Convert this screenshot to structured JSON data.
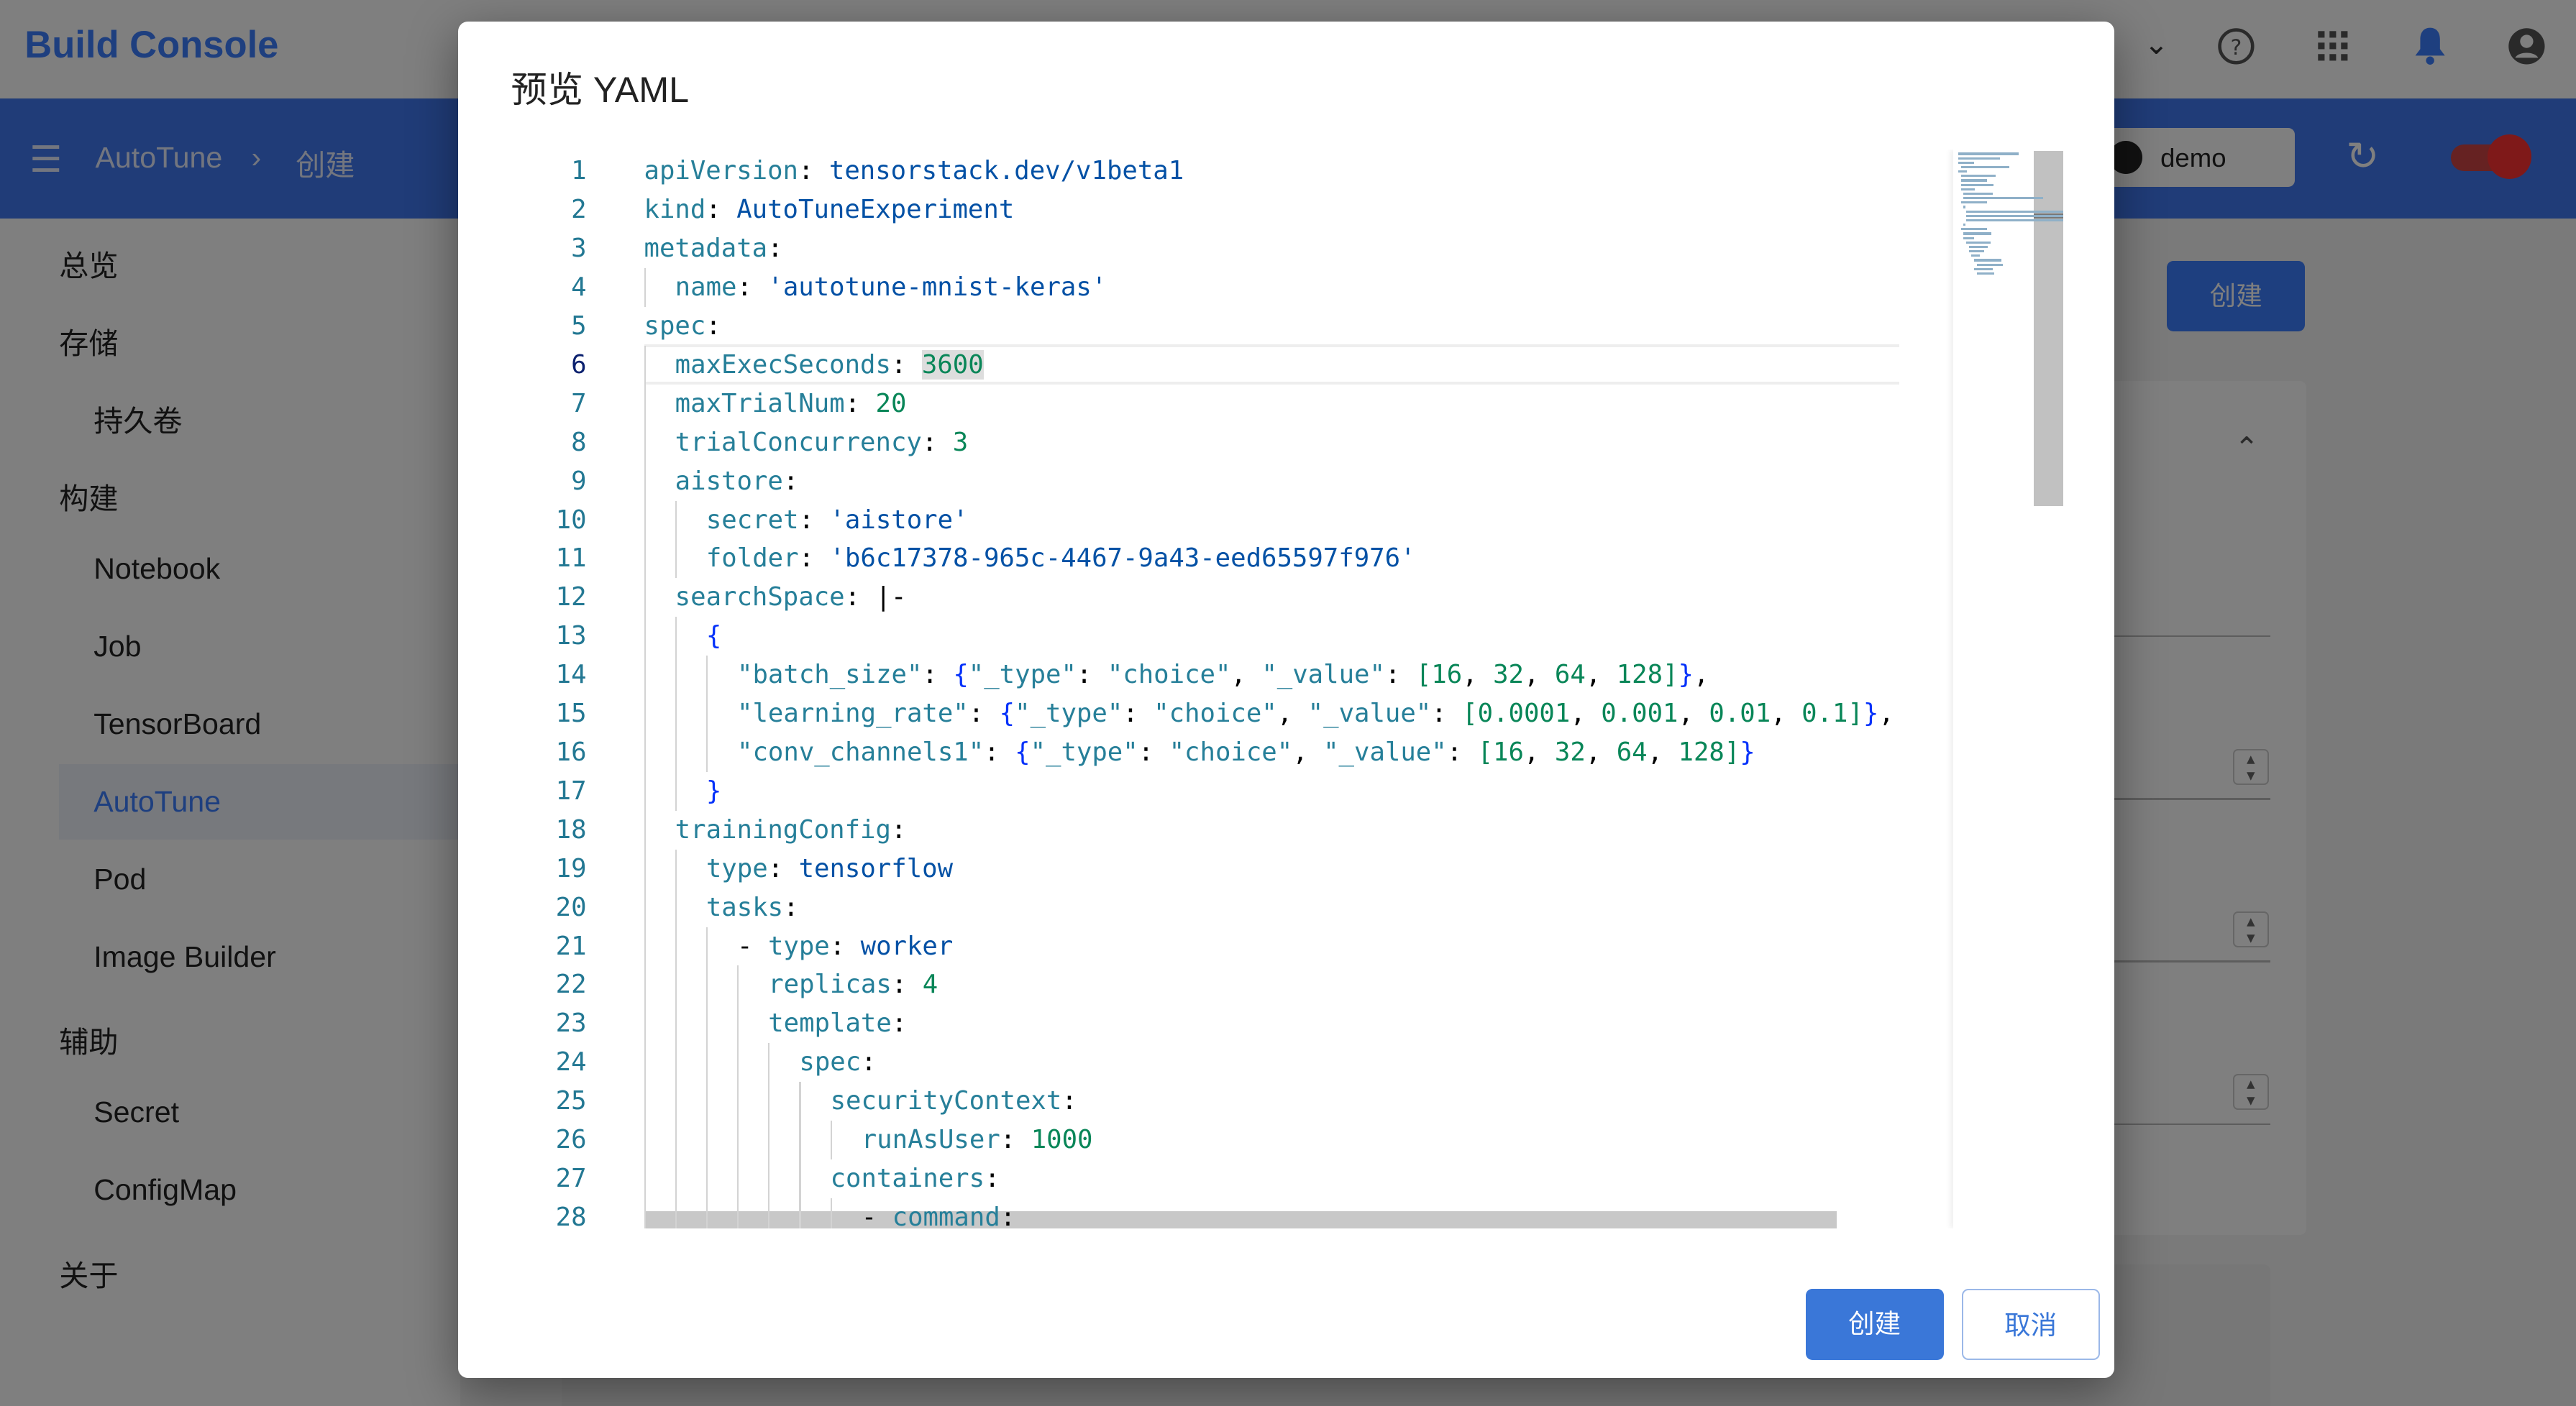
{
  "app": {
    "title": "Build Console",
    "accent": "#3d7eff"
  },
  "header": {
    "icons": [
      "chevron-down-icon",
      "help-icon",
      "apps-icon",
      "bell-icon",
      "account-icon"
    ]
  },
  "navbar": {
    "breadcrumb": [
      "AutoTune",
      "创建"
    ],
    "project": "demo"
  },
  "sidebar": {
    "items": [
      {
        "label": "总览",
        "level": 0
      },
      {
        "label": "存储",
        "level": 0
      },
      {
        "label": "持久卷",
        "level": 1
      },
      {
        "label": "构建",
        "level": 0
      },
      {
        "label": "Notebook",
        "level": 1
      },
      {
        "label": "Job",
        "level": 1
      },
      {
        "label": "TensorBoard",
        "level": 1
      },
      {
        "label": "AutoTune",
        "level": 1,
        "selected": true
      },
      {
        "label": "Pod",
        "level": 1
      },
      {
        "label": "Image Builder",
        "level": 1
      },
      {
        "label": "辅助",
        "level": 0
      },
      {
        "label": "Secret",
        "level": 1
      },
      {
        "label": "ConfigMap",
        "level": 1
      },
      {
        "label": "关于",
        "level": 0
      }
    ]
  },
  "main": {
    "create_label": "创建"
  },
  "dialog": {
    "title": "预览 YAML",
    "confirm_label": "创建",
    "cancel_label": "取消",
    "current_line": 6,
    "lines": [
      {
        "i": 0,
        "t": [
          [
            "k",
            "apiVersion"
          ],
          [
            "p",
            ": "
          ],
          [
            "s",
            "tensorstack.dev/v1beta1"
          ]
        ]
      },
      {
        "i": 0,
        "t": [
          [
            "k",
            "kind"
          ],
          [
            "p",
            ": "
          ],
          [
            "s",
            "AutoTuneExperiment"
          ]
        ]
      },
      {
        "i": 0,
        "t": [
          [
            "k",
            "metadata"
          ],
          [
            "p",
            ":"
          ]
        ]
      },
      {
        "i": 1,
        "t": [
          [
            "k",
            "name"
          ],
          [
            "p",
            ": "
          ],
          [
            "s",
            "'autotune-mnist-keras'"
          ]
        ]
      },
      {
        "i": 0,
        "t": [
          [
            "k",
            "spec"
          ],
          [
            "p",
            ":"
          ]
        ]
      },
      {
        "i": 1,
        "t": [
          [
            "k",
            "maxExecSeconds"
          ],
          [
            "p",
            ": "
          ],
          [
            "n",
            "3600"
          ]
        ]
      },
      {
        "i": 1,
        "t": [
          [
            "k",
            "maxTrialNum"
          ],
          [
            "p",
            ": "
          ],
          [
            "n",
            "20"
          ]
        ]
      },
      {
        "i": 1,
        "t": [
          [
            "k",
            "trialConcurrency"
          ],
          [
            "p",
            ": "
          ],
          [
            "n",
            "3"
          ]
        ]
      },
      {
        "i": 1,
        "t": [
          [
            "k",
            "aistore"
          ],
          [
            "p",
            ":"
          ]
        ]
      },
      {
        "i": 2,
        "t": [
          [
            "k",
            "secret"
          ],
          [
            "p",
            ": "
          ],
          [
            "s",
            "'aistore'"
          ]
        ]
      },
      {
        "i": 2,
        "t": [
          [
            "k",
            "folder"
          ],
          [
            "p",
            ": "
          ],
          [
            "s",
            "'b6c17378-965c-4467-9a43-eed65597f976'"
          ]
        ]
      },
      {
        "i": 1,
        "t": [
          [
            "k",
            "searchSpace"
          ],
          [
            "p",
            ": |-"
          ]
        ]
      },
      {
        "i": 2,
        "t": [
          [
            "b",
            "{"
          ]
        ]
      },
      {
        "i": 3,
        "t": [
          [
            "q",
            "\"batch_size\""
          ],
          [
            "p",
            ": "
          ],
          [
            "b",
            "{"
          ],
          [
            "q",
            "\"_type\""
          ],
          [
            "p",
            ": "
          ],
          [
            "q",
            "\"choice\""
          ],
          [
            "p",
            ", "
          ],
          [
            "q",
            "\"_value\""
          ],
          [
            "p",
            ": "
          ],
          [
            "n",
            "[16"
          ],
          [
            "p",
            ", "
          ],
          [
            "n",
            "32"
          ],
          [
            "p",
            ", "
          ],
          [
            "n",
            "64"
          ],
          [
            "p",
            ", "
          ],
          [
            "n",
            "128]"
          ],
          [
            "b",
            "}"
          ],
          [
            "p",
            ","
          ]
        ]
      },
      {
        "i": 3,
        "t": [
          [
            "q",
            "\"learning_rate\""
          ],
          [
            "p",
            ": "
          ],
          [
            "b",
            "{"
          ],
          [
            "q",
            "\"_type\""
          ],
          [
            "p",
            ": "
          ],
          [
            "q",
            "\"choice\""
          ],
          [
            "p",
            ", "
          ],
          [
            "q",
            "\"_value\""
          ],
          [
            "p",
            ": "
          ],
          [
            "n",
            "[0.0001"
          ],
          [
            "p",
            ", "
          ],
          [
            "n",
            "0.001"
          ],
          [
            "p",
            ", "
          ],
          [
            "n",
            "0.01"
          ],
          [
            "p",
            ", "
          ],
          [
            "n",
            "0.1]"
          ],
          [
            "b",
            "}"
          ],
          [
            "p",
            ","
          ]
        ]
      },
      {
        "i": 3,
        "t": [
          [
            "q",
            "\"conv_channels1\""
          ],
          [
            "p",
            ": "
          ],
          [
            "b",
            "{"
          ],
          [
            "q",
            "\"_type\""
          ],
          [
            "p",
            ": "
          ],
          [
            "q",
            "\"choice\""
          ],
          [
            "p",
            ", "
          ],
          [
            "q",
            "\"_value\""
          ],
          [
            "p",
            ": "
          ],
          [
            "n",
            "[16"
          ],
          [
            "p",
            ", "
          ],
          [
            "n",
            "32"
          ],
          [
            "p",
            ", "
          ],
          [
            "n",
            "64"
          ],
          [
            "p",
            ", "
          ],
          [
            "n",
            "128]"
          ],
          [
            "b",
            "}"
          ]
        ]
      },
      {
        "i": 2,
        "t": [
          [
            "b",
            "}"
          ]
        ]
      },
      {
        "i": 1,
        "t": [
          [
            "k",
            "trainingConfig"
          ],
          [
            "p",
            ":"
          ]
        ]
      },
      {
        "i": 2,
        "t": [
          [
            "k",
            "type"
          ],
          [
            "p",
            ": "
          ],
          [
            "s",
            "tensorflow"
          ]
        ]
      },
      {
        "i": 2,
        "t": [
          [
            "k",
            "tasks"
          ],
          [
            "p",
            ":"
          ]
        ]
      },
      {
        "i": 3,
        "t": [
          [
            "p",
            "- "
          ],
          [
            "k",
            "type"
          ],
          [
            "p",
            ": "
          ],
          [
            "s",
            "worker"
          ]
        ]
      },
      {
        "i": 4,
        "t": [
          [
            "k",
            "replicas"
          ],
          [
            "p",
            ": "
          ],
          [
            "n",
            "4"
          ]
        ]
      },
      {
        "i": 4,
        "t": [
          [
            "k",
            "template"
          ],
          [
            "p",
            ":"
          ]
        ]
      },
      {
        "i": 5,
        "t": [
          [
            "k",
            "spec"
          ],
          [
            "p",
            ":"
          ]
        ]
      },
      {
        "i": 6,
        "t": [
          [
            "k",
            "securityContext"
          ],
          [
            "p",
            ":"
          ]
        ]
      },
      {
        "i": 7,
        "t": [
          [
            "k",
            "runAsUser"
          ],
          [
            "p",
            ": "
          ],
          [
            "n",
            "1000"
          ]
        ]
      },
      {
        "i": 6,
        "t": [
          [
            "k",
            "containers"
          ],
          [
            "p",
            ":"
          ]
        ]
      },
      {
        "i": 7,
        "t": [
          [
            "p",
            "- "
          ],
          [
            "k",
            "command"
          ],
          [
            "p",
            ":"
          ]
        ]
      }
    ]
  }
}
